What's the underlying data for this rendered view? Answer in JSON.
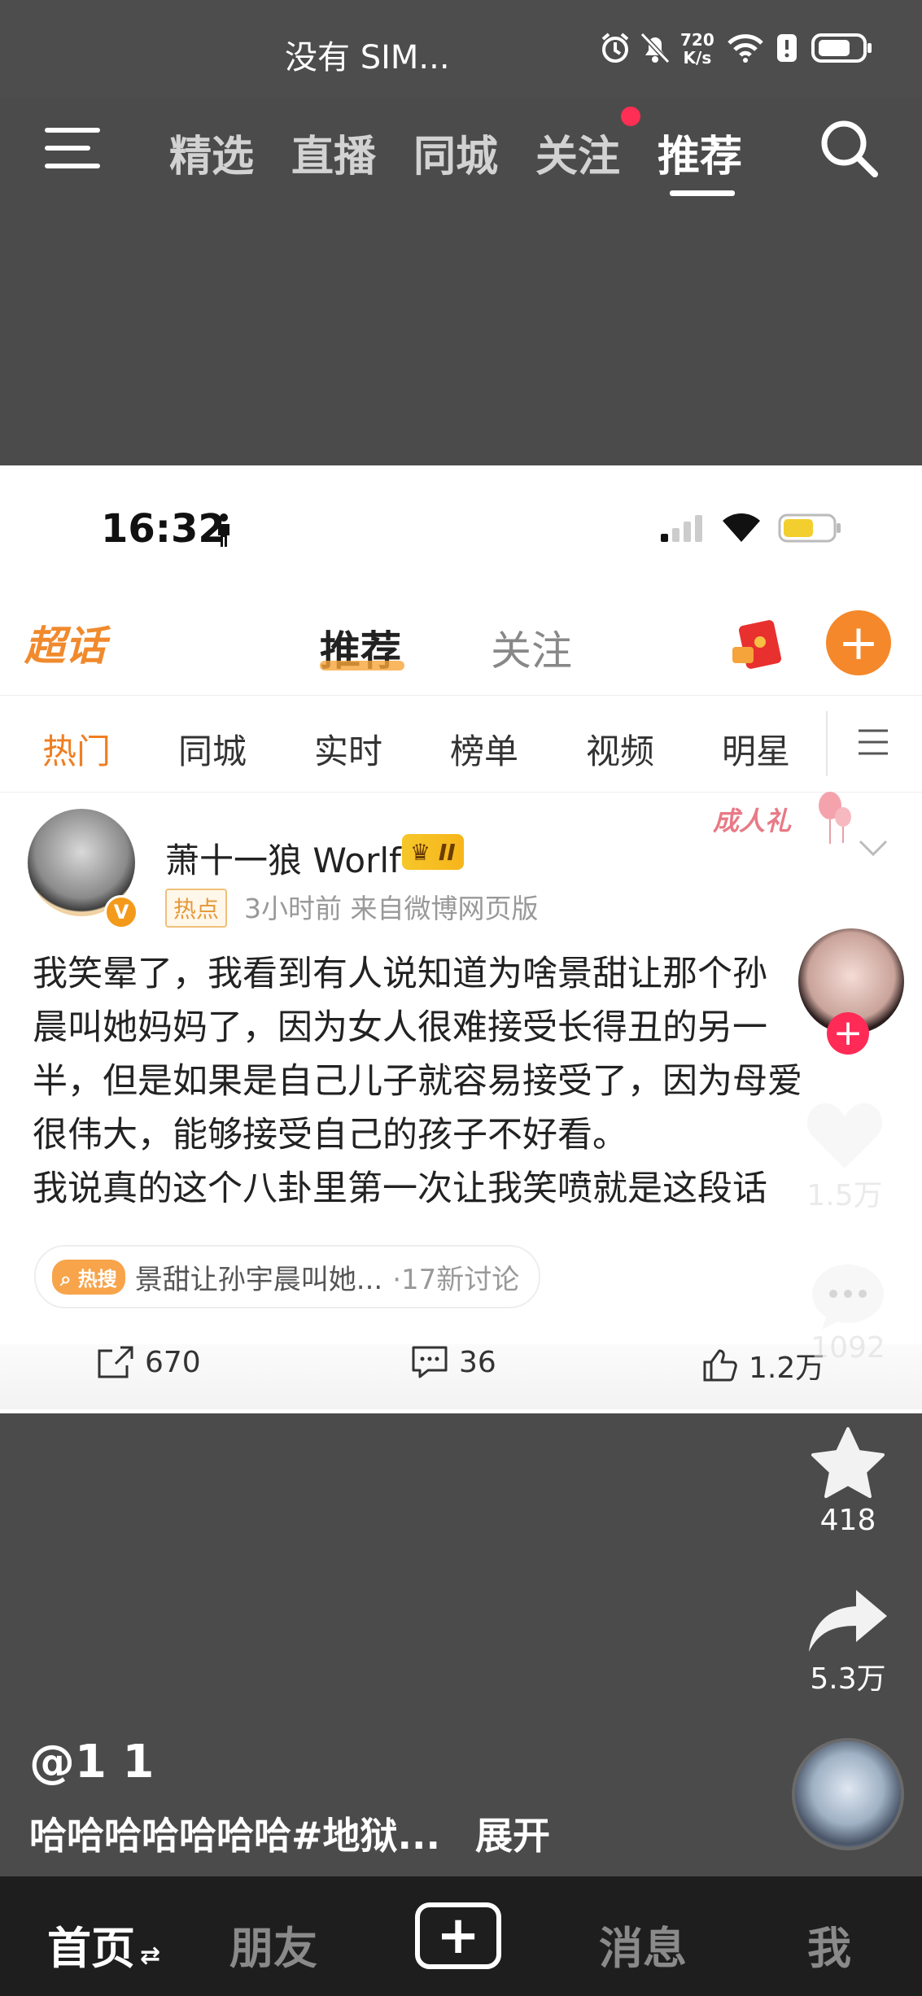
{
  "status_bar": {
    "carrier": "没有 SIM...",
    "network_speed_value": "720",
    "network_speed_unit": "K/s"
  },
  "top_tabs": [
    "精选",
    "直播",
    "同城",
    "关注",
    "推荐"
  ],
  "active_top_tab": "推荐",
  "embedded": {
    "time": "16:32",
    "header": {
      "logo": "超话",
      "tab_recommend": "推荐",
      "tab_follow": "关注"
    },
    "categories": [
      "热门",
      "同城",
      "实时",
      "榜单",
      "视频",
      "明星"
    ],
    "active_category": "热门",
    "post": {
      "username": "萧十一狼 Worlf",
      "vip_level": "II",
      "hot_tag": "热点",
      "meta": "3小时前  来自微博网页版",
      "sticker": "成人礼",
      "text_lines": [
        "我笑晕了，我看到有人说知道为啥景甜让那个孙",
        "晨叫她妈妈了，因为女人很难接受长得丑的另一",
        "半，但是如果是自己儿子就容易接受了，因为母爱",
        "很伟大，能够接受自己的孩子不好看。",
        "我说真的这个八卦里第一次让我笑喷就是这段话"
      ],
      "topic": {
        "badge": "热搜",
        "title": "景甜让孙宇晨叫她...",
        "count": "·17新讨论"
      },
      "actions": {
        "share": "670",
        "comment": "36",
        "like": "1.2万"
      }
    }
  },
  "right_actions": {
    "like_count": "1.5万",
    "comment_count": "1092",
    "favorite_count": "418",
    "share_count": "5.3万"
  },
  "video": {
    "author": "@1 1",
    "caption": "哈哈哈哈哈哈哈#地狱...",
    "expand": "展开"
  },
  "bottom_nav": {
    "home": "首页",
    "friends": "朋友",
    "messages": "消息",
    "me": "我"
  },
  "colors": {
    "weibo_orange": "#f5882a",
    "notification_red": "#ff2e55",
    "follow_plus_red": "#ff2b56"
  }
}
